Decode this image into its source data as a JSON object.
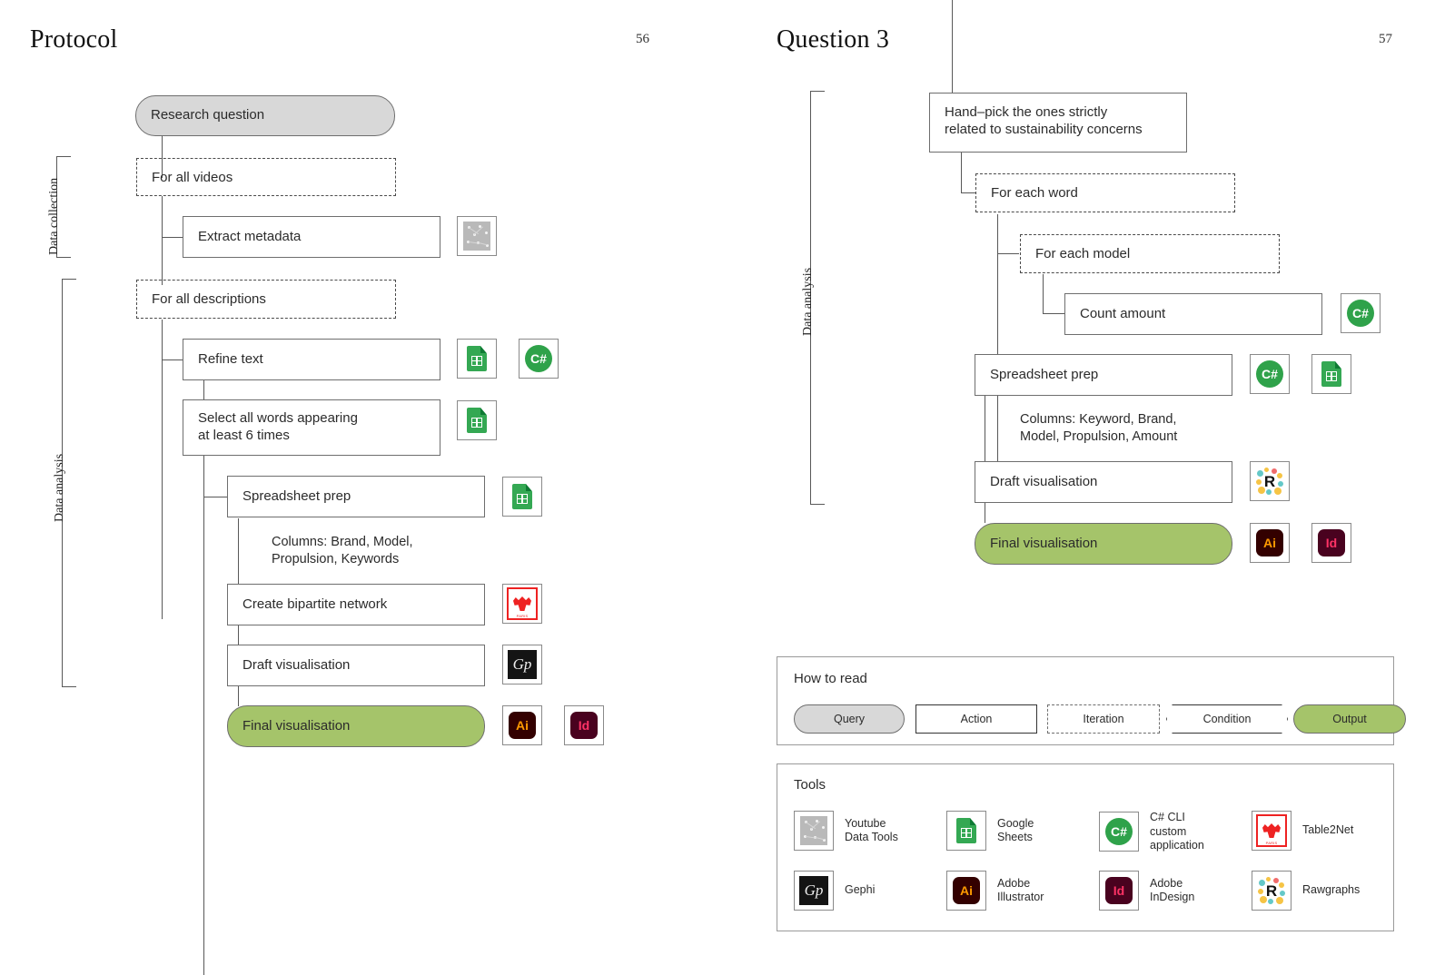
{
  "pages": [
    {
      "title": "Protocol",
      "number": "56",
      "side_labels": [
        "Data collection",
        "Data analysis"
      ],
      "nodes": [
        {
          "kind": "query",
          "label": "Research question"
        },
        {
          "kind": "iteration",
          "label": "For all videos"
        },
        {
          "kind": "action",
          "label": "Extract metadata"
        },
        {
          "kind": "iteration",
          "label": "For all descriptions"
        },
        {
          "kind": "action",
          "label": "Refine text"
        },
        {
          "kind": "action",
          "label": "Select all words appearing\nat least 6 times"
        },
        {
          "kind": "action",
          "label": "Spreadsheet prep"
        },
        {
          "kind": "action",
          "label": "Create bipartite network"
        },
        {
          "kind": "action",
          "label": "Draft visualisation"
        },
        {
          "kind": "output",
          "label": "Final visualisation"
        }
      ],
      "notes": [
        {
          "text": "Columns: Brand, Model,\nPropulsion, Keywords"
        }
      ]
    },
    {
      "title": "Question 3",
      "number": "57",
      "side_labels": [
        "Data analysis"
      ],
      "nodes": [
        {
          "kind": "action",
          "label": "Hand–pick the ones strictly\nrelated to sustainability concerns"
        },
        {
          "kind": "iteration",
          "label": "For each word"
        },
        {
          "kind": "iteration",
          "label": "For each model"
        },
        {
          "kind": "action",
          "label": "Count amount"
        },
        {
          "kind": "action",
          "label": "Spreadsheet prep"
        },
        {
          "kind": "action",
          "label": "Draft visualisation"
        },
        {
          "kind": "output",
          "label": "Final visualisation"
        }
      ],
      "notes": [
        {
          "text": "Columns: Keyword, Brand,\nModel, Propulsion, Amount"
        }
      ]
    }
  ],
  "how_to_read": {
    "title": "How to read",
    "items": [
      {
        "kind": "query",
        "label": "Query"
      },
      {
        "kind": "action",
        "label": "Action"
      },
      {
        "kind": "iteration",
        "label": "Iteration"
      },
      {
        "kind": "condition",
        "label": "Condition"
      },
      {
        "kind": "output",
        "label": "Output"
      }
    ]
  },
  "tools": {
    "title": "Tools",
    "items": [
      {
        "icon": "youtube-data-tools-icon",
        "label": "Youtube\nData Tools"
      },
      {
        "icon": "google-sheets-icon",
        "label": "Google\nSheets"
      },
      {
        "icon": "csharp-icon",
        "label": "C# CLI\ncustom\napplication"
      },
      {
        "icon": "table2net-icon",
        "label": "Table2Net"
      },
      {
        "icon": "gephi-icon",
        "label": "Gephi"
      },
      {
        "icon": "adobe-illustrator-icon",
        "label": "Adobe\nIllustrator"
      },
      {
        "icon": "adobe-indesign-icon",
        "label": "Adobe\nInDesign"
      },
      {
        "icon": "rawgraphs-icon",
        "label": "Rawgraphs"
      }
    ]
  },
  "chip_icons": {
    "extract_metadata": [
      "youtube-data-tools-icon"
    ],
    "refine_text": [
      "google-sheets-icon",
      "csharp-icon"
    ],
    "select_words": [
      "google-sheets-icon"
    ],
    "spreadsheet_prep_left": [
      "google-sheets-icon"
    ],
    "create_bipartite": [
      "table2net-icon"
    ],
    "draft_vis_left": [
      "gephi-icon"
    ],
    "final_vis_left": [
      "adobe-illustrator-icon",
      "adobe-indesign-icon"
    ],
    "count_amount": [
      "csharp-icon"
    ],
    "spreadsheet_prep_right": [
      "csharp-icon",
      "google-sheets-icon"
    ],
    "draft_vis_right": [
      "rawgraphs-icon"
    ],
    "final_vis_right": [
      "adobe-illustrator-icon",
      "adobe-indesign-icon"
    ]
  },
  "colors": {
    "query_fill": "#d8d8d8",
    "output_fill": "#a5c46a",
    "stroke": "#6e6e6e",
    "connector": "#585858",
    "sheets_green": "#34a853",
    "csharp_green": "#2fa24a",
    "illustrator_bg": "#330000",
    "illustrator_fg": "#ff9a00",
    "indesign_bg": "#49021f",
    "indesign_fg": "#ff3366",
    "table2net_red": "#ee2222"
  },
  "glyphs": {
    "csharp": "C#",
    "illustrator": "Ai",
    "indesign": "Id",
    "gephi": "Gp",
    "rawgraphs": "R",
    "table2net_caption": "PARIS"
  }
}
